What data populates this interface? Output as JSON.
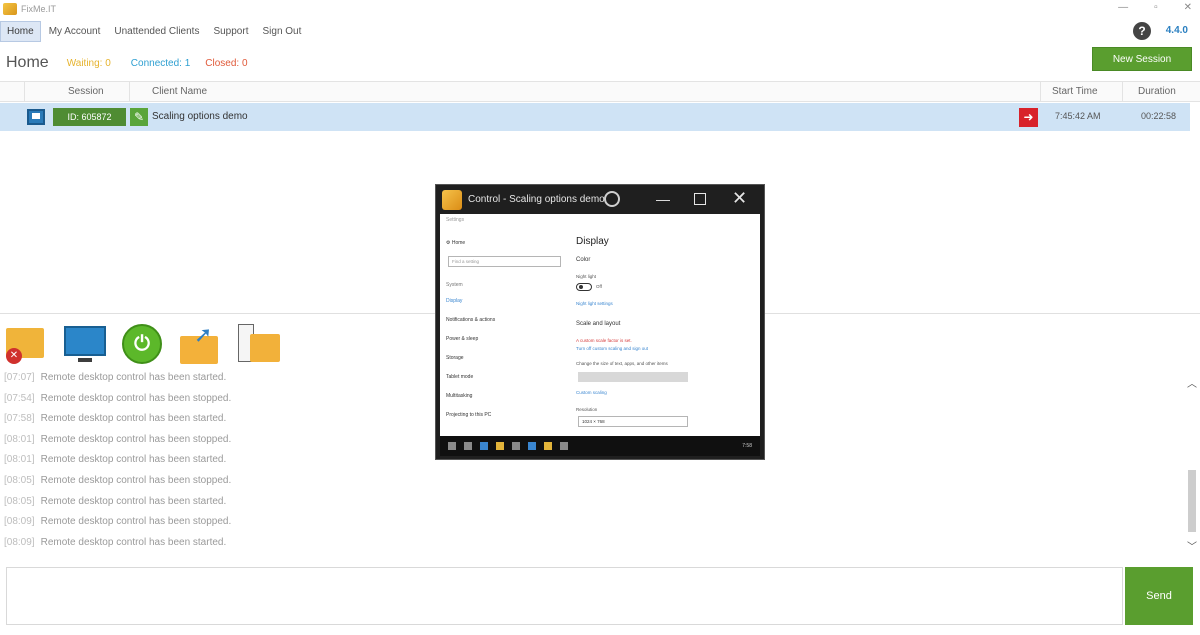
{
  "app": {
    "title": "FixMe.IT",
    "version": "4.4.0"
  },
  "menu": [
    {
      "label": "Home",
      "active": true
    },
    {
      "label": "My Account"
    },
    {
      "label": "Unattended Clients"
    },
    {
      "label": "Support"
    },
    {
      "label": "Sign Out"
    }
  ],
  "home": {
    "title": "Home",
    "waiting": "Waiting: 0",
    "connected": "Connected: 1",
    "closed": "Closed: 0",
    "new_session": "New Session"
  },
  "table": {
    "headers": {
      "session": "Session",
      "client": "Client Name",
      "start": "Start Time",
      "duration": "Duration"
    },
    "row": {
      "id": "ID: 605872",
      "name": "Scaling options demo",
      "start": "7:45:42 AM",
      "duration": "00:22:58"
    }
  },
  "actions": [
    {
      "icon": "remove-folder-icon"
    },
    {
      "icon": "remote-screen-icon"
    },
    {
      "icon": "power-icon"
    },
    {
      "icon": "file-share-icon"
    },
    {
      "icon": "file-transfer-icon"
    }
  ],
  "log": [
    {
      "time": "[07:07]",
      "text": "Remote desktop control has been started."
    },
    {
      "time": "[07:54]",
      "text": "Remote desktop control has been stopped."
    },
    {
      "time": "[07:58]",
      "text": "Remote desktop control has been started."
    },
    {
      "time": "[08:01]",
      "text": "Remote desktop control has been stopped."
    },
    {
      "time": "[08:01]",
      "text": "Remote desktop control has been started."
    },
    {
      "time": "[08:05]",
      "text": "Remote desktop control has been stopped."
    },
    {
      "time": "[08:05]",
      "text": "Remote desktop control has been started."
    },
    {
      "time": "[08:09]",
      "text": "Remote desktop control has been stopped."
    },
    {
      "time": "[08:09]",
      "text": "Remote desktop control has been started."
    }
  ],
  "chat": {
    "send": "Send"
  },
  "remote": {
    "title": "Control - Scaling options demo",
    "settings": {
      "top": "Settings",
      "home": "Home",
      "search": "Find a setting",
      "section": "System",
      "side": [
        "Display",
        "Notifications & actions",
        "Power & sleep",
        "Storage",
        "Tablet mode",
        "Multitasking",
        "Projecting to this PC"
      ],
      "heading": "Display",
      "color": "Color",
      "night_light": "Night light",
      "toggle_state": "Off",
      "night_link": "Night light settings",
      "scale_heading": "Scale and layout",
      "warning": "A custom scale factor is set.",
      "warning_link": "Turn off custom scaling and sign out",
      "change_size": "Change the size of text, apps, and other items",
      "custom_scaling": "Custom scaling",
      "resolution": "Resolution",
      "resolution_value": "1024 × 768"
    },
    "clock": "7:58"
  }
}
